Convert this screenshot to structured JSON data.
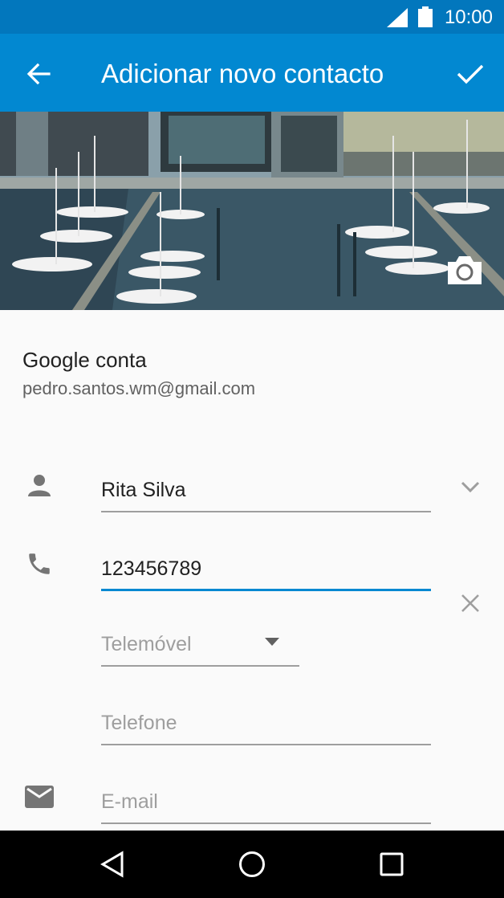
{
  "status_bar": {
    "time": "10:00",
    "icons": [
      "signal-icon",
      "battery-icon"
    ]
  },
  "app_bar": {
    "title": "Adicionar novo contacto",
    "back_icon": "arrow-left-icon",
    "save_icon": "check-icon",
    "color": "#0288d1",
    "status_color": "#0277bd"
  },
  "photo": {
    "description_icon": "camera-icon"
  },
  "account": {
    "label": "Google conta",
    "email": "pedro.santos.wm@gmail.com"
  },
  "form": {
    "name": {
      "value": "Rita Silva",
      "icon": "person-icon",
      "expand_icon": "chevron-down-icon"
    },
    "phone": {
      "value": "123456789",
      "icon": "phone-icon",
      "clear_icon": "close-icon"
    },
    "phone_type": {
      "selected": "Telemóvel",
      "dropdown_icon": "dropdown-triangle-icon"
    },
    "second_phone": {
      "placeholder": "Telefone"
    },
    "email": {
      "placeholder": "E-mail",
      "icon": "email-icon"
    }
  },
  "nav_bar": {
    "buttons": [
      "back-nav-icon",
      "home-nav-icon",
      "recents-nav-icon"
    ]
  }
}
